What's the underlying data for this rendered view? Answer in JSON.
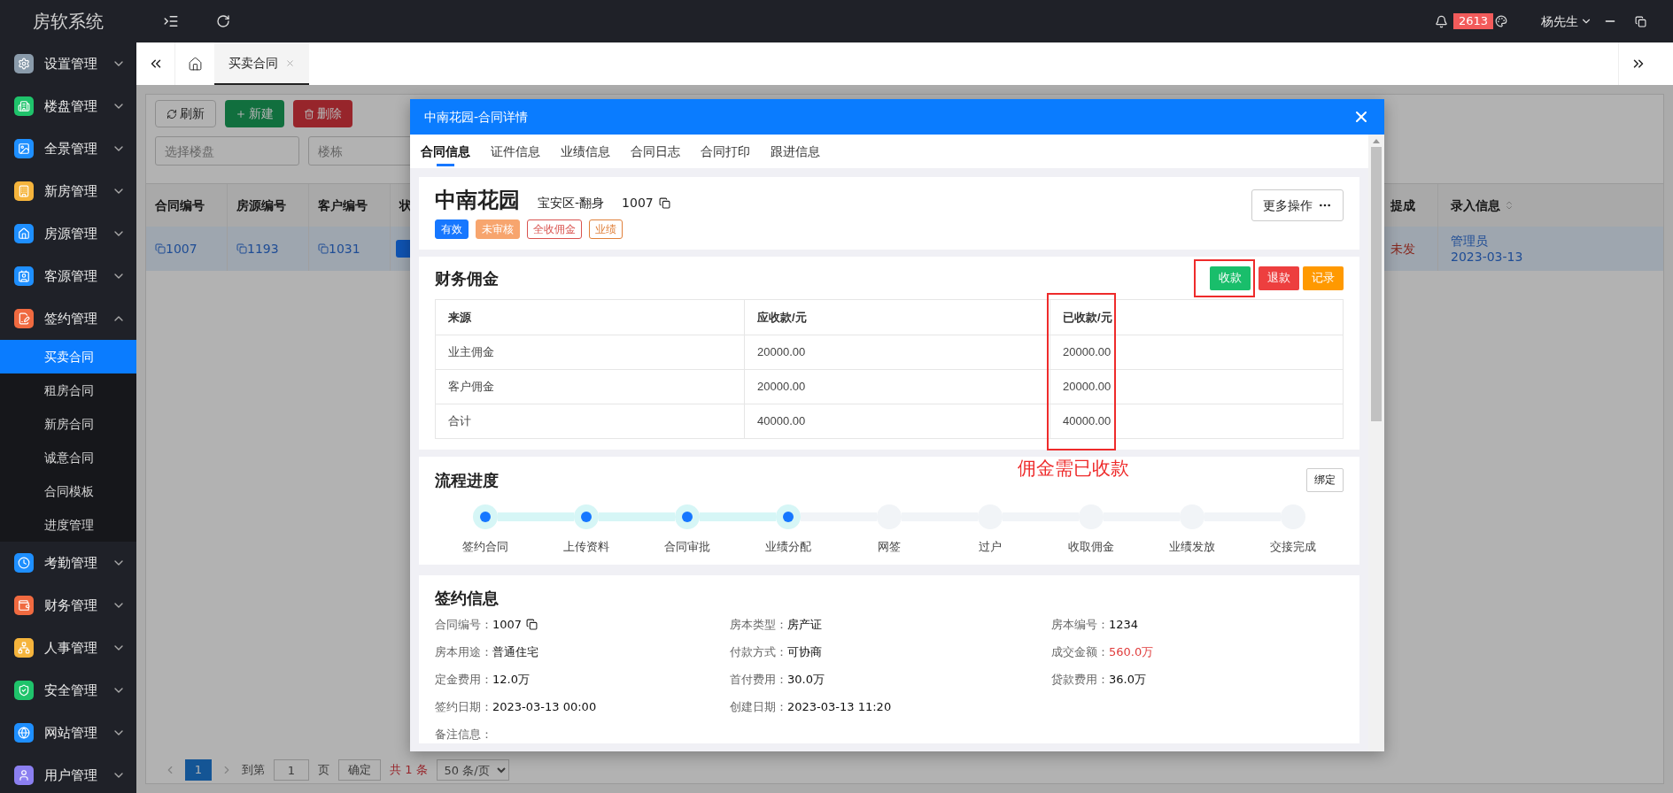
{
  "app": {
    "title": "房软系统"
  },
  "topbar": {
    "notification_count": "2613",
    "user": "杨先生"
  },
  "sidebar": {
    "items": [
      {
        "label": "设置管理",
        "color": "#8a9bab",
        "expanded": false
      },
      {
        "label": "楼盘管理",
        "color": "#1fc36b",
        "expanded": false
      },
      {
        "label": "全景管理",
        "color": "#1e8fff",
        "expanded": false
      },
      {
        "label": "新房管理",
        "color": "#f5b43c",
        "expanded": false
      },
      {
        "label": "房源管理",
        "color": "#1e8fff",
        "expanded": false
      },
      {
        "label": "客源管理",
        "color": "#1e8fff",
        "expanded": false
      },
      {
        "label": "签约管理",
        "color": "#f06a40",
        "expanded": true,
        "children": [
          {
            "label": "买卖合同",
            "selected": true
          },
          {
            "label": "租房合同",
            "selected": false
          },
          {
            "label": "新房合同",
            "selected": false
          },
          {
            "label": "诚意合同",
            "selected": false
          },
          {
            "label": "合同模板",
            "selected": false
          },
          {
            "label": "进度管理",
            "selected": false
          }
        ]
      },
      {
        "label": "考勤管理",
        "color": "#1e8fff",
        "expanded": false
      },
      {
        "label": "财务管理",
        "color": "#f06a40",
        "expanded": false
      },
      {
        "label": "人事管理",
        "color": "#f5b43c",
        "expanded": false
      },
      {
        "label": "安全管理",
        "color": "#1fc36b",
        "expanded": false
      },
      {
        "label": "网站管理",
        "color": "#1e8fff",
        "expanded": false
      },
      {
        "label": "用户管理",
        "color": "#8b7ff0",
        "expanded": false
      }
    ]
  },
  "page_tabs": [
    {
      "label": "买卖合同",
      "selected": true
    }
  ],
  "toolbar": {
    "buttons": [
      {
        "label": "刷新",
        "kind": "refresh"
      },
      {
        "label": "新建",
        "kind": "create"
      },
      {
        "label": "删除",
        "kind": "delete"
      }
    ],
    "filters": [
      {
        "placeholder": "选择楼盘"
      },
      {
        "placeholder": "楼栋"
      }
    ]
  },
  "table": {
    "columns_left": [
      "合同编号",
      "房源编号",
      "客户编号",
      "状"
    ],
    "columns_right": [
      "提成",
      "录入信息"
    ],
    "rows": [
      {
        "selected": true,
        "links": [
          "1007",
          "1193",
          "1031"
        ],
        "commission": "未发",
        "entered_by": "管理员",
        "entered_date": "2023-03-13"
      }
    ]
  },
  "pagination": {
    "pages": [
      {
        "label": "1",
        "selected": true
      }
    ],
    "goto_label": "到第",
    "goto_value": "1",
    "page_unit": "页",
    "confirm": "确定",
    "total": "共 1 条",
    "page_size": "50 条/页"
  },
  "modal": {
    "title": "中南花园-合同详情",
    "tabs": [
      {
        "label": "合同信息",
        "selected": true
      },
      {
        "label": "证件信息",
        "selected": false
      },
      {
        "label": "业绩信息",
        "selected": false
      },
      {
        "label": "合同日志",
        "selected": false
      },
      {
        "label": "合同打印",
        "selected": false
      },
      {
        "label": "跟进信息",
        "selected": false
      }
    ],
    "header": {
      "name": "中南花园",
      "district": "宝安区-翻身",
      "number": "1007",
      "more_button": "更多操作",
      "tags": [
        {
          "label": "有效",
          "kind": "solid",
          "color": "#1677ff"
        },
        {
          "label": "未审核",
          "kind": "solid",
          "color": "#f7a56e"
        },
        {
          "label": "全收佣金",
          "kind": "outline",
          "color": "#d9534f"
        },
        {
          "label": "业绩",
          "kind": "outline",
          "color": "#e0803a"
        }
      ]
    },
    "finance": {
      "title": "财务佣金",
      "buttons": [
        {
          "label": "收款",
          "color": "#19be6b"
        },
        {
          "label": "退款",
          "color": "#ed3f3f"
        },
        {
          "label": "记录",
          "color": "#ff9900"
        }
      ],
      "columns": [
        "来源",
        "应收款/元",
        "已收款/元"
      ],
      "rows": [
        [
          "业主佣金",
          "20000.00",
          "20000.00"
        ],
        [
          "客户佣金",
          "20000.00",
          "20000.00"
        ],
        [
          "合计",
          "40000.00",
          "40000.00"
        ]
      ],
      "annotation": "佣金需已收款"
    },
    "progress": {
      "title": "流程进度",
      "button": "绑定",
      "steps": [
        {
          "label": "签约合同",
          "done": true
        },
        {
          "label": "上传资料",
          "done": true
        },
        {
          "label": "合同审批",
          "done": true
        },
        {
          "label": "业绩分配",
          "done": true
        },
        {
          "label": "网签",
          "done": false
        },
        {
          "label": "过户",
          "done": false
        },
        {
          "label": "收取佣金",
          "done": false
        },
        {
          "label": "业绩发放",
          "done": false
        },
        {
          "label": "交接完成",
          "done": false
        }
      ]
    },
    "signing": {
      "title": "签约信息",
      "fields": [
        {
          "label": "合同编号：",
          "value": "1007",
          "copyable": true
        },
        {
          "label": "房本类型：",
          "value": "房产证",
          "copyable": false
        },
        {
          "label": "房本编号：",
          "value": "1234",
          "copyable": false
        },
        {
          "label": "房本用途：",
          "value": "普通住宅",
          "copyable": false
        },
        {
          "label": "付款方式：",
          "value": "可协商",
          "copyable": false
        },
        {
          "label": "成交金额：",
          "value": "560.0万",
          "copyable": false,
          "color": "#e03c3c"
        },
        {
          "label": "定金费用：",
          "value": "12.0万",
          "copyable": false
        },
        {
          "label": "首付费用：",
          "value": "30.0万",
          "copyable": false
        },
        {
          "label": "贷款费用：",
          "value": "36.0万",
          "copyable": false
        },
        {
          "label": "签约日期：",
          "value": "2023-03-13 00:00",
          "copyable": false
        },
        {
          "label": "创建日期：",
          "value": "2023-03-13 11:20",
          "copyable": false
        }
      ],
      "remark_label": "备注信息："
    }
  }
}
